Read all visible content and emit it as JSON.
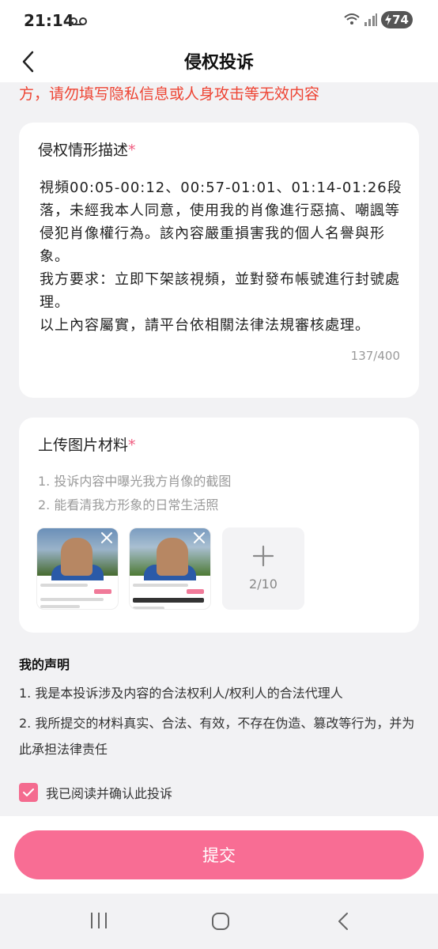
{
  "status_bar": {
    "time": "21:14",
    "battery": "74"
  },
  "header": {
    "title": "侵权投诉"
  },
  "notice": "方，请勿填写隐私信息或人身攻击等无效内容",
  "description_card": {
    "title": "侵权情形描述",
    "required_mark": "*",
    "text": "視頻00:05-00:12、00:57-01:01、01:14-01:26段落，未經我本人同意，使用我的肖像進行惡搞、嘲諷等侵犯肖像權行為。該內容嚴重損害我的個人名譽與形象。\n我方要求：立即下架該視頻，並對發布帳號進行封號處理。\n以上內容屬實，請平台依相關法律法規審核處理。",
    "counter": "137/400"
  },
  "upload_card": {
    "title": "上传图片材料",
    "required_mark": "*",
    "hints": [
      "1. 投诉内容中曝光我方肖像的截图",
      "2. 能看清我方形象的日常生活照"
    ],
    "image_count": "2/10"
  },
  "declaration": {
    "title": "我的声明",
    "items": [
      "1. 我是本投诉涉及内容的合法权利人/权利人的合法代理人",
      "2. 我所提交的材料真实、合法、有效，不存在伪造、篡改等行为，并为此承担法律责任"
    ],
    "agree_label": "我已阅读并确认此投诉",
    "agreed": true
  },
  "submit_label": "提交",
  "colors": {
    "accent": "#f86d94",
    "warning": "#ee4433",
    "checkbox": "#f46b8f"
  }
}
